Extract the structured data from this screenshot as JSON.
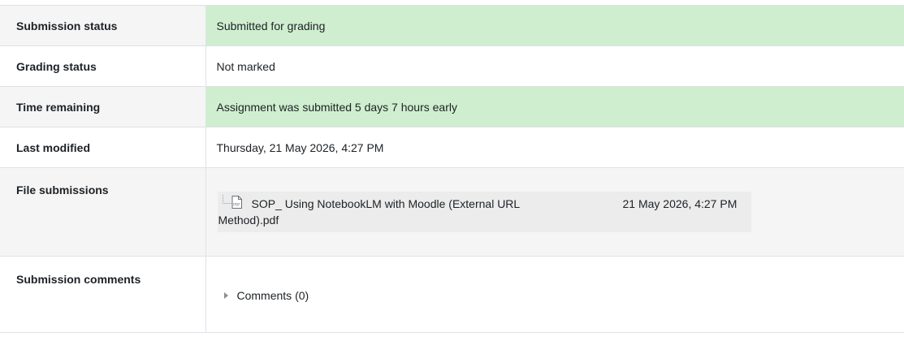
{
  "submission": {
    "rows": [
      {
        "label": "Submission status",
        "value": "Submitted for grading"
      },
      {
        "label": "Grading status",
        "value": "Not marked"
      },
      {
        "label": "Time remaining",
        "value": "Assignment was submitted 5 days 7 hours early"
      },
      {
        "label": "Last modified",
        "value": "Thursday, 21 May 2026, 4:27 PM"
      }
    ],
    "files": {
      "label": "File submissions",
      "file_name_line1": "SOP_ Using NotebookLM with Moodle (External URL",
      "file_name_line2": "Method).pdf",
      "file_date": "21 May 2026, 4:27 PM",
      "icon": "pdf-file-icon"
    },
    "comments": {
      "label": "Submission comments",
      "toggle_label": "Comments (0)"
    }
  },
  "colors": {
    "success_bg": "#cfeecf",
    "stripe_bg": "#f5f5f5",
    "border": "#dee2e6",
    "text": "#1d2125"
  }
}
